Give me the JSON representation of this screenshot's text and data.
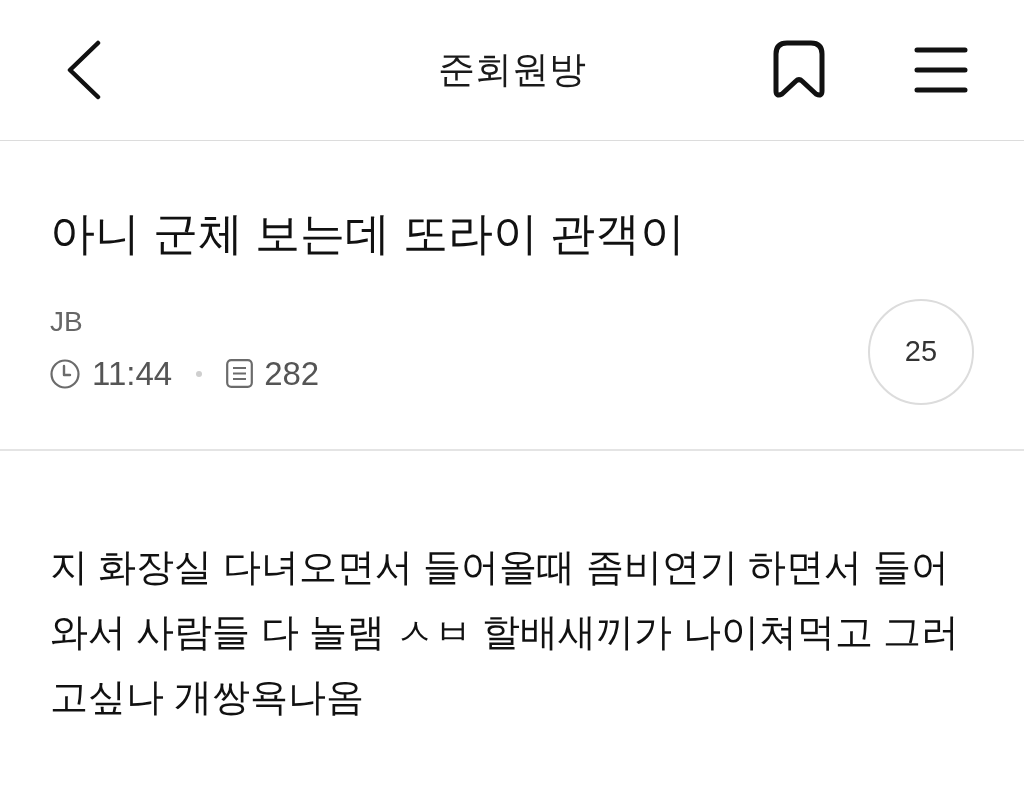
{
  "header": {
    "title": "준회원방"
  },
  "post": {
    "title": "아니 군체 보는데 또라이 관객이",
    "author": "JB",
    "meta": [
      {
        "kind": "time",
        "text": "11:44"
      },
      {
        "kind": "views",
        "text": "282"
      }
    ],
    "count_badge": "25"
  },
  "body": "지 화장실 다녀오면서 들어올때 좀비연기 하면서 들어와서 사람들 다 놀램 ㅅㅂ 할배새끼가 나이쳐먹고 그러고싶나 개쌍욕나옴"
}
